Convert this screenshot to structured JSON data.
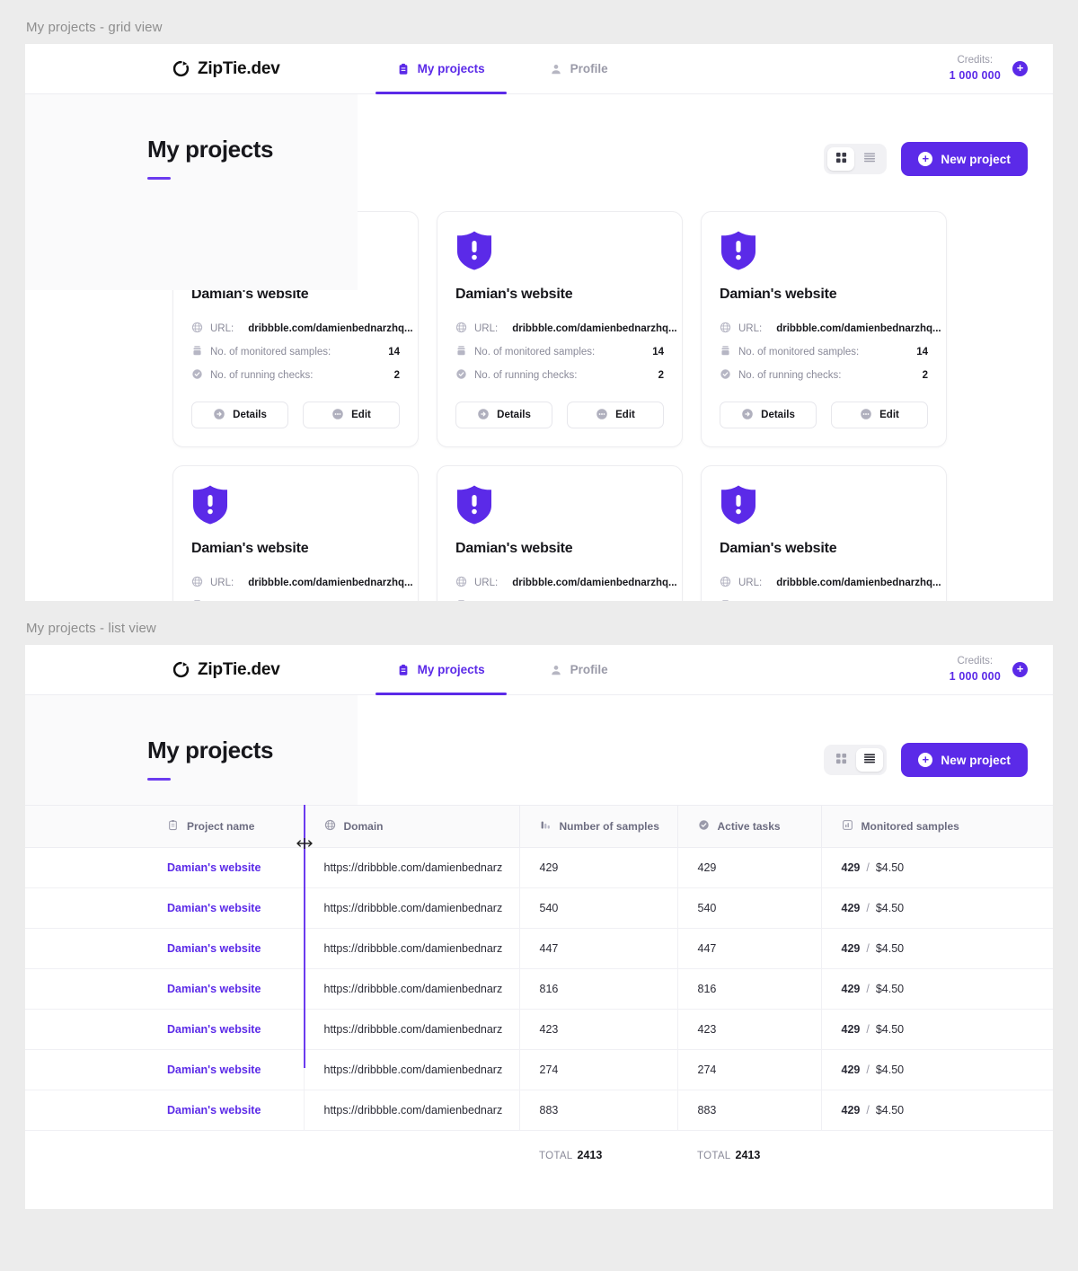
{
  "sections": [
    {
      "label": "My projects - grid view"
    },
    {
      "label": "My projects - list view"
    }
  ],
  "brand": {
    "name": "ZipTie.dev",
    "logo_icon": "ziptie-circle-logo"
  },
  "nav": {
    "links": [
      {
        "label": "My projects",
        "icon": "clipboard-icon",
        "active": true
      },
      {
        "label": "Profile",
        "icon": "person-icon",
        "active": false
      }
    ],
    "credits_label": "Credits:",
    "credits_value": "1 000 000",
    "add_credits_icon": "plus-circle-icon"
  },
  "page": {
    "title": "My projects",
    "new_project_label": "New project",
    "new_project_icon": "plus-circle-icon",
    "view_grid_icon": "grid-view-icon",
    "view_list_icon": "list-view-icon"
  },
  "card": {
    "status_icon": "shield-alert-icon",
    "title": "Damian's website",
    "url_label": "URL:",
    "url_value": "dribbble.com/damienbednarzhq...",
    "url_icon": "globe-icon",
    "samples_label": "No. of monitored samples:",
    "samples_value": "14",
    "samples_icon": "samples-icon",
    "checks_label": "No. of running checks:",
    "checks_value": "2",
    "checks_icon": "check-circle-icon",
    "details_label": "Details",
    "details_icon": "arrow-right-circle-icon",
    "edit_label": "Edit",
    "edit_icon": "dots-circle-icon"
  },
  "cards_count_row1": 3,
  "cards_count_row2": 3,
  "table": {
    "columns": [
      {
        "label": "Project name",
        "icon": "clipboard-icon"
      },
      {
        "label": "Domain",
        "icon": "globe-icon"
      },
      {
        "label": "Number of samples",
        "icon": "bar-chart-icon"
      },
      {
        "label": "Active tasks",
        "icon": "check-circle-icon"
      },
      {
        "label": "Monitored samples",
        "icon": "chart-square-icon"
      }
    ],
    "rows": [
      {
        "name": "Damian's website",
        "domain": "https://dribbble.com/damienbednarz",
        "samples": "429",
        "tasks": "429",
        "monitored": "429",
        "price": "$4.50"
      },
      {
        "name": "Damian's website",
        "domain": "https://dribbble.com/damienbednarz",
        "samples": "540",
        "tasks": "540",
        "monitored": "429",
        "price": "$4.50"
      },
      {
        "name": "Damian's website",
        "domain": "https://dribbble.com/damienbednarz",
        "samples": "447",
        "tasks": "447",
        "monitored": "429",
        "price": "$4.50"
      },
      {
        "name": "Damian's website",
        "domain": "https://dribbble.com/damienbednarz",
        "samples": "816",
        "tasks": "816",
        "monitored": "429",
        "price": "$4.50"
      },
      {
        "name": "Damian's website",
        "domain": "https://dribbble.com/damienbednarz",
        "samples": "423",
        "tasks": "423",
        "monitored": "429",
        "price": "$4.50"
      },
      {
        "name": "Damian's website",
        "domain": "https://dribbble.com/damienbednarz",
        "samples": "274",
        "tasks": "274",
        "monitored": "429",
        "price": "$4.50"
      },
      {
        "name": "Damian's website",
        "domain": "https://dribbble.com/damienbednarz",
        "samples": "883",
        "tasks": "883",
        "monitored": "429",
        "price": "$4.50"
      }
    ],
    "separator": "/",
    "total_label": "TOTAL",
    "total_samples": "2413",
    "total_tasks": "2413"
  },
  "colors": {
    "accent": "#5b2ae8",
    "accent_light": "#6b3bef",
    "page_bg": "#ececec",
    "panel_bg": "#fafafb",
    "muted_text": "#8a8a99"
  }
}
